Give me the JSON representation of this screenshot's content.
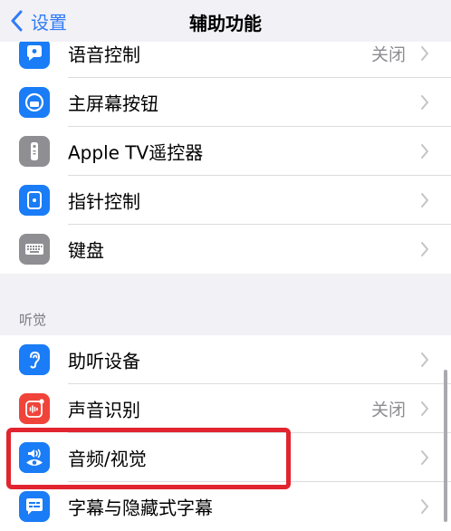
{
  "nav": {
    "back_label": "设置",
    "title": "辅助功能"
  },
  "group1": [
    {
      "label": "语音控制",
      "value": "关闭",
      "icon": "voice-control-icon",
      "icon_bg": "#1a7cf6"
    },
    {
      "label": "主屏幕按钮",
      "value": "",
      "icon": "home-button-icon",
      "icon_bg": "#1a7cf6"
    },
    {
      "label": "Apple TV遥控器",
      "value": "",
      "icon": "tv-remote-icon",
      "icon_bg": "#8e8e93"
    },
    {
      "label": "指针控制",
      "value": "",
      "icon": "pointer-control-icon",
      "icon_bg": "#1a7cf6"
    },
    {
      "label": "键盘",
      "value": "",
      "icon": "keyboard-icon",
      "icon_bg": "#8e8e93"
    }
  ],
  "section_hearing": "听觉",
  "group2": [
    {
      "label": "助听设备",
      "value": "",
      "icon": "hearing-device-icon",
      "icon_bg": "#1a7cf6"
    },
    {
      "label": "声音识别",
      "value": "关闭",
      "icon": "sound-recognition-icon",
      "icon_bg": "#f0443a"
    },
    {
      "label": "音频/视觉",
      "value": "",
      "icon": "audio-visual-icon",
      "icon_bg": "#1a7cf6"
    },
    {
      "label": "字幕与隐藏式字幕",
      "value": "",
      "icon": "subtitles-icon",
      "icon_bg": "#1a7cf6"
    }
  ],
  "colors": {
    "accent": "#2f7cf6",
    "highlight": "#e1242f"
  }
}
